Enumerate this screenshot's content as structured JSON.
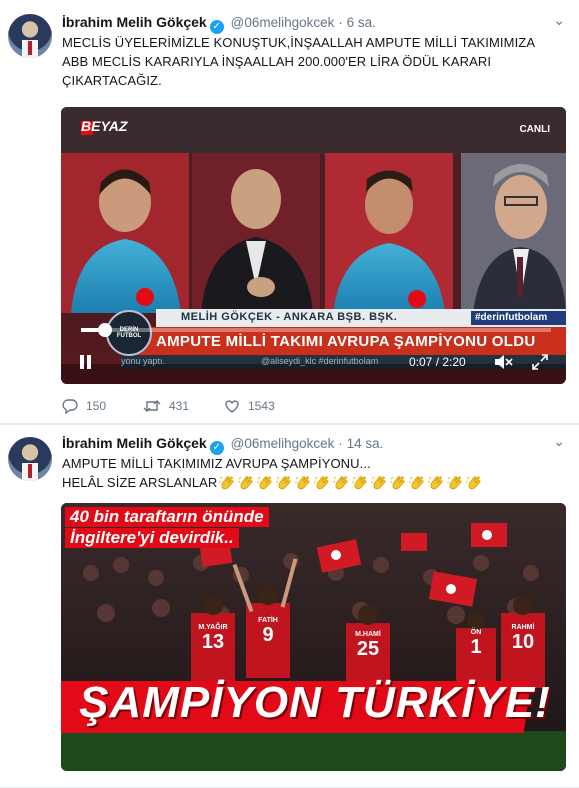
{
  "tweets": [
    {
      "name": "İbrahim Melih Gökçek",
      "handle": "@06melihgokcek",
      "time": "6 sa.",
      "text_lines": [
        "MECLİS ÜYELERİMİZLE KONUŞTUK,İNŞAALLAH AMPUTE MİLLİ TAKIMIMIZA",
        "ABB MECLİS KARARIYLA İNŞAALLAH 200.000'ER LİRA ÖDÜL KARARI",
        "ÇIKARTACAĞIZ."
      ],
      "video": {
        "channel": "BEYAZ",
        "live": "CANLI",
        "lower_third": "MELİH GÖKÇEK - ANKARA BŞB. BŞK.",
        "hashtag": "#derinfutbolam",
        "logo": "DERİN FUTBOL",
        "headline": "AMPUTE MİLLİ TAKIMI AVRUPA ŞAMPİYONU OLDU",
        "ticker": "@aliseydi_klc  #derinfutbolam",
        "ticker_left": "yonu yaptı.",
        "time_display": "0:07 / 2:20",
        "progress": 0.05
      },
      "replies": "150",
      "retweets": "431",
      "likes": "1543"
    },
    {
      "name": "İbrahim Melih Gökçek",
      "handle": "@06melihgokcek",
      "time": "14 sa.",
      "text_line1": "AMPUTE MİLLİ TAKIMIMIZ AVRUPA ŞAMPİYONU...",
      "text_line2": "HELÂL SİZE ARSLANLAR",
      "clap_count": 14,
      "image": {
        "headline_1": "40 bin taraftarın önünde",
        "headline_2": "İngiltere'yi devirdik..",
        "banner": "ŞAMPİYON TÜRKİYE!",
        "jerseys": [
          {
            "num": "13",
            "name": "M.YAĞIR"
          },
          {
            "num": "9",
            "name": "FATİH"
          },
          {
            "num": "25",
            "name": "M.HAMİ"
          },
          {
            "num": "1",
            "name": "ÖN"
          },
          {
            "num": "10",
            "name": "RAHMİ"
          }
        ]
      }
    }
  ],
  "colors": {
    "blue": "#1da1f2",
    "grey": "#657786",
    "red": "#e30a17",
    "text": "#14171a"
  },
  "icons": [
    "chevron-down-icon",
    "verified-badge-icon",
    "reply-icon",
    "retweet-icon",
    "like-icon",
    "play-pause-icon",
    "volume-icon",
    "fullscreen-icon",
    "clapping-hands-icon"
  ]
}
